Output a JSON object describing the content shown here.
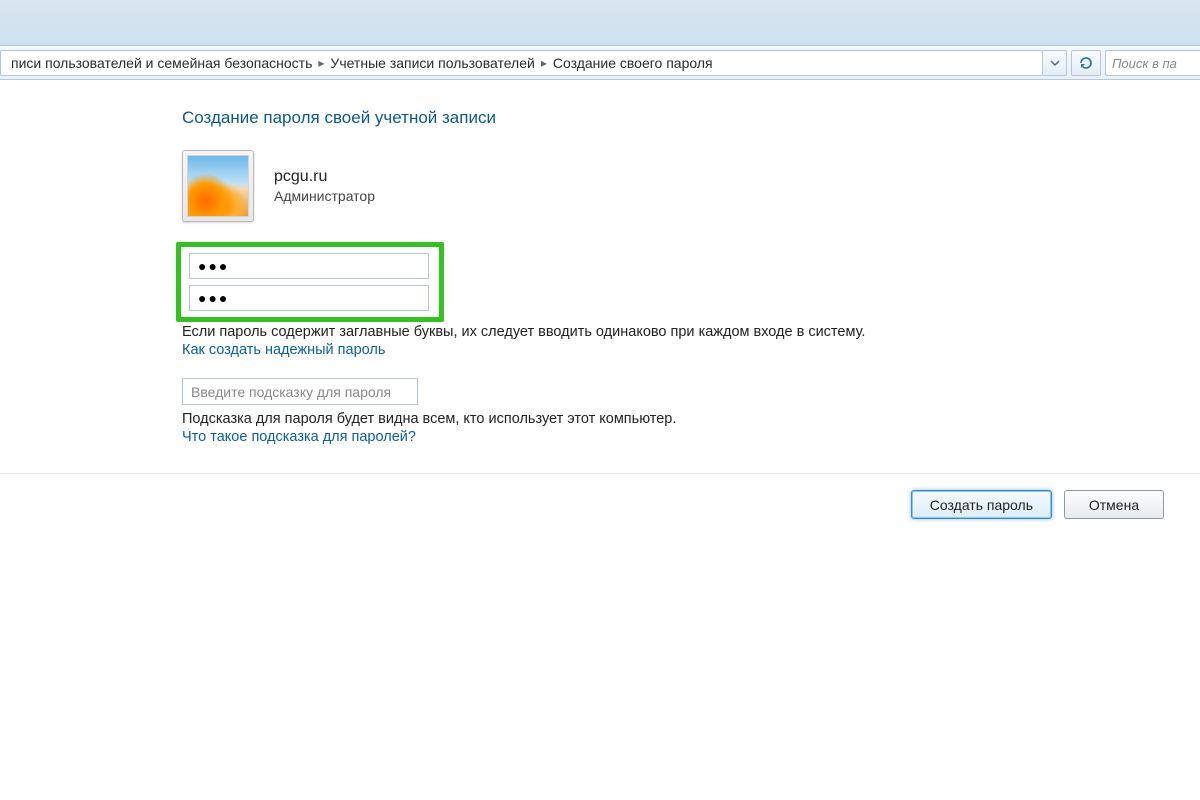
{
  "breadcrumb": {
    "items": [
      "писи пользователей и семейная безопасность",
      "Учетные записи пользователей",
      "Создание своего пароля"
    ]
  },
  "search": {
    "placeholder": "Поиск в па"
  },
  "page": {
    "title": "Создание пароля своей учетной записи"
  },
  "account": {
    "name": "pcgu.ru",
    "role": "Администратор"
  },
  "password": {
    "value1": "●●●",
    "value2": "●●●",
    "caps_note": "Если пароль содержит заглавные буквы, их следует вводить одинаково при каждом входе в систему.",
    "howto_link": "Как создать надежный пароль"
  },
  "hint": {
    "placeholder": "Введите подсказку для пароля",
    "visible_note": "Подсказка для пароля будет видна всем, кто использует этот компьютер.",
    "what_is_link": "Что такое подсказка для паролей?"
  },
  "buttons": {
    "create": "Создать пароль",
    "cancel": "Отмена"
  }
}
